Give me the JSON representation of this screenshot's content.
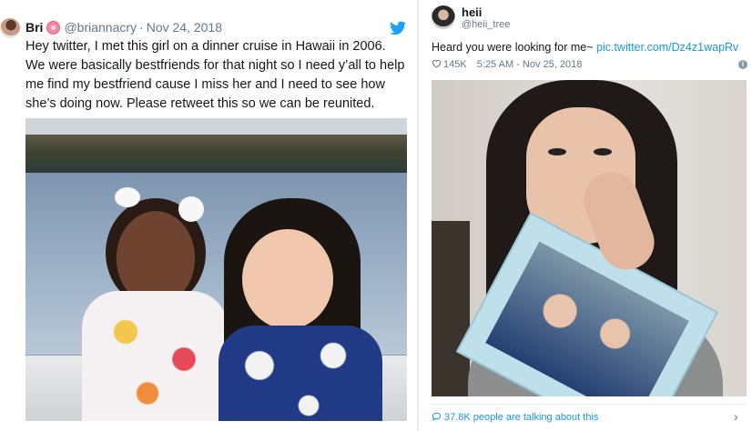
{
  "left_tweet": {
    "name": "Bri",
    "emoji_name": "hibiscus-emoji",
    "handle": "@briannacry",
    "separator": "·",
    "date": "Nov 24, 2018",
    "text": "Hey twitter, I met this girl on a dinner cruise in Hawaii in 2006. We were basically bestfriends for that night so I need y’all to help me find my bestfriend cause I miss her and I need to see how she’s doing now. Please retweet this so we can be reunited.",
    "brand_icon": "twitter-bird-icon"
  },
  "right_tweet": {
    "name": "heii",
    "handle": "@heii_tree",
    "text": "Heard you were looking for me~ ",
    "link": "pic.twitter.com/Dz4z1wapRv",
    "likes": "145K",
    "time": "5:25 AM - Nov 25, 2018",
    "separator": "·",
    "talking": "37.8K people are talking about this",
    "info_symbol": "i",
    "chevron": "›"
  },
  "colors": {
    "accent": "#1b95e0",
    "text": "#14171a",
    "muted": "#657786"
  }
}
